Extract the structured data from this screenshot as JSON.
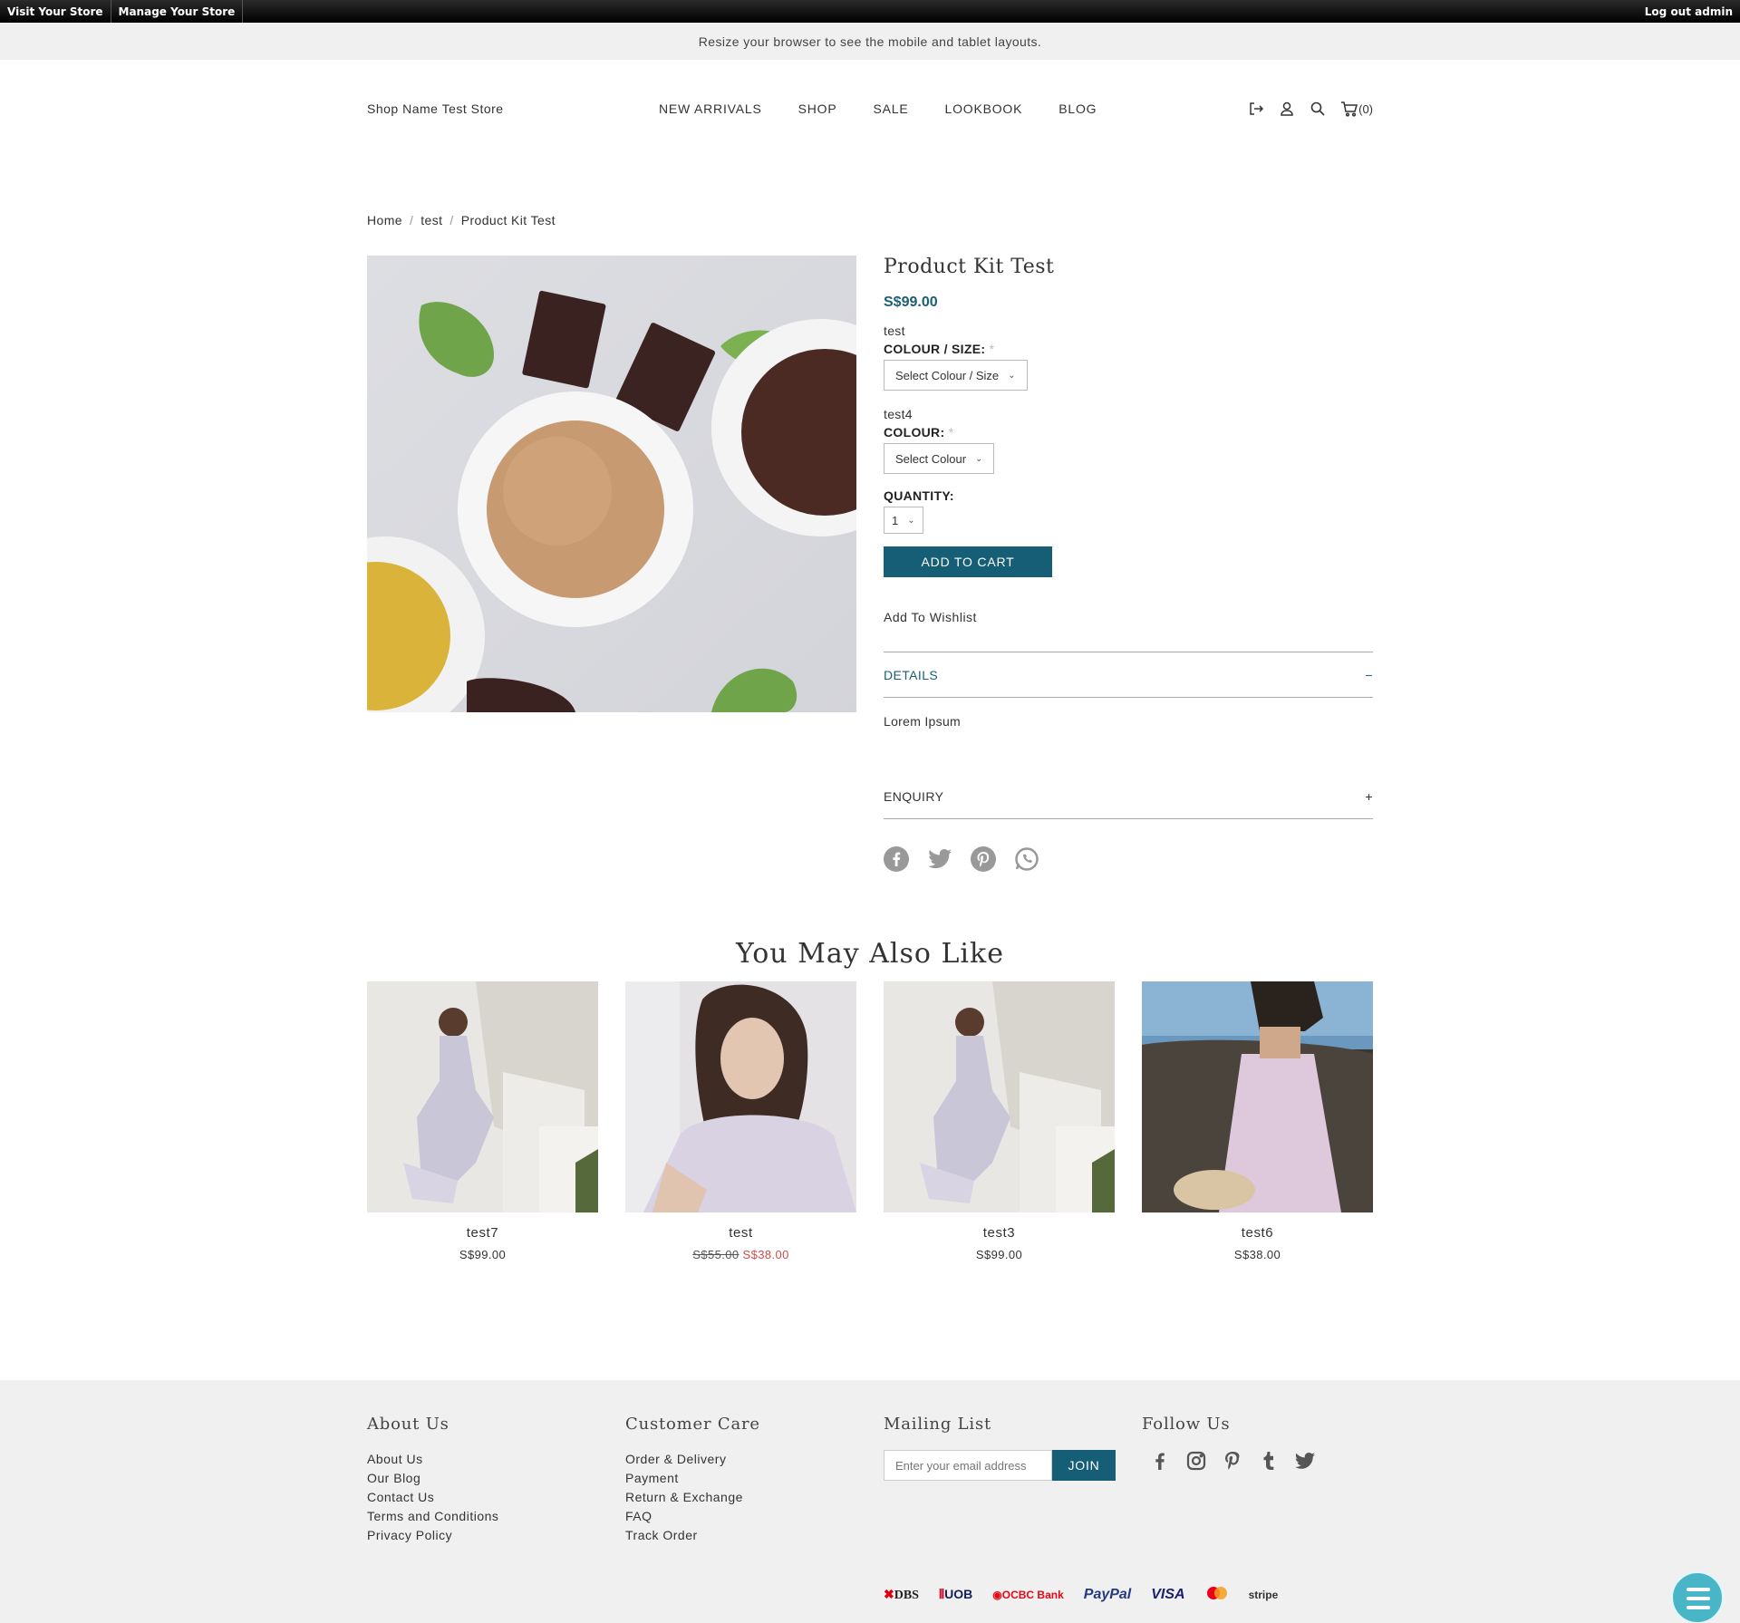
{
  "admin_bar": {
    "visit_store": "Visit Your Store",
    "manage_store": "Manage Your Store",
    "logout": "Log out admin"
  },
  "notice": "Resize your browser to see the mobile and tablet layouts.",
  "header": {
    "shop_name": "Shop Name Test Store",
    "nav": [
      "NEW ARRIVALS",
      "SHOP",
      "SALE",
      "LOOKBOOK",
      "BLOG"
    ],
    "cart_count": "(0)"
  },
  "breadcrumb": [
    "Home",
    "test",
    "Product Kit Test"
  ],
  "product": {
    "title": "Product Kit Test",
    "price": "S$99.00",
    "option1": {
      "name": "test",
      "label": "COLOUR / SIZE:",
      "required": "*",
      "placeholder": "Select Colour / Size"
    },
    "option2": {
      "name": "test4",
      "label": "COLOUR:",
      "required": "*",
      "placeholder": "Select Colour"
    },
    "quantity_label": "QUANTITY:",
    "quantity": "1",
    "add_to_cart": "ADD TO CART",
    "wishlist": "Add To Wishlist",
    "details_label": "DETAILS",
    "details_toggle": "−",
    "details_body": "Lorem Ipsum",
    "enquiry_label": "ENQUIRY",
    "enquiry_toggle": "+"
  },
  "related": {
    "title": "You May Also Like",
    "items": [
      {
        "name": "test7",
        "price": "S$99.00"
      },
      {
        "name": "test",
        "old_price": "S$55.00",
        "sale_price": "S$38.00"
      },
      {
        "name": "test3",
        "price": "S$99.00"
      },
      {
        "name": "test6",
        "price": "S$38.00"
      }
    ]
  },
  "footer": {
    "about": {
      "title": "About Us",
      "links": [
        "About Us",
        "Our Blog",
        "Contact Us",
        "Terms and Conditions",
        "Privacy Policy"
      ]
    },
    "care": {
      "title": "Customer Care",
      "links": [
        "Order & Delivery",
        "Payment",
        "Return & Exchange",
        "FAQ",
        "Track Order"
      ]
    },
    "mailing": {
      "title": "Mailing List",
      "placeholder": "Enter your email address",
      "join": "JOIN"
    },
    "follow": {
      "title": "Follow Us"
    },
    "payments": [
      "DBS",
      "UOB",
      "OCBC Bank",
      "PayPal",
      "VISA",
      "stripe"
    ]
  },
  "colors": {
    "accent": "#155e75",
    "sale": "#d04b4b",
    "footer_bg": "#f0f0f0",
    "chat": "#48b6c6"
  }
}
